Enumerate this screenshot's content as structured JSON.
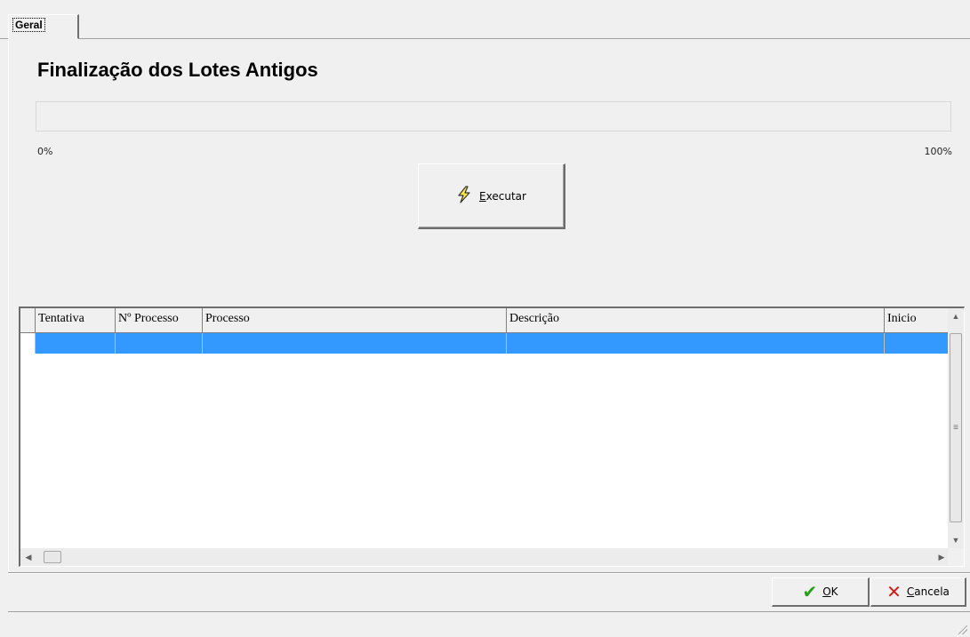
{
  "tabs": [
    {
      "label": "Geral"
    }
  ],
  "page": {
    "title": "Finalização dos Lotes Antigos"
  },
  "progress": {
    "value_percent": 0,
    "min_label": "0%",
    "max_label": "100%"
  },
  "execute_button": {
    "label": "Executar",
    "icon": "lightning-bolt-icon"
  },
  "grid": {
    "columns": [
      "Tentativa",
      "Nº Processo",
      "Processo",
      "Descrição",
      "Inicio"
    ],
    "rows": [
      {
        "selected": true,
        "cells": [
          "",
          "",
          "",
          "",
          ""
        ]
      }
    ]
  },
  "footer": {
    "ok_label": "OK",
    "ok_icon": "checkmark-icon",
    "cancel_label": "Cancela",
    "cancel_icon": "x-icon"
  },
  "colors": {
    "selection": "#3399ff",
    "ok_check": "#2a9d1e",
    "cancel_x": "#d01c1c"
  }
}
